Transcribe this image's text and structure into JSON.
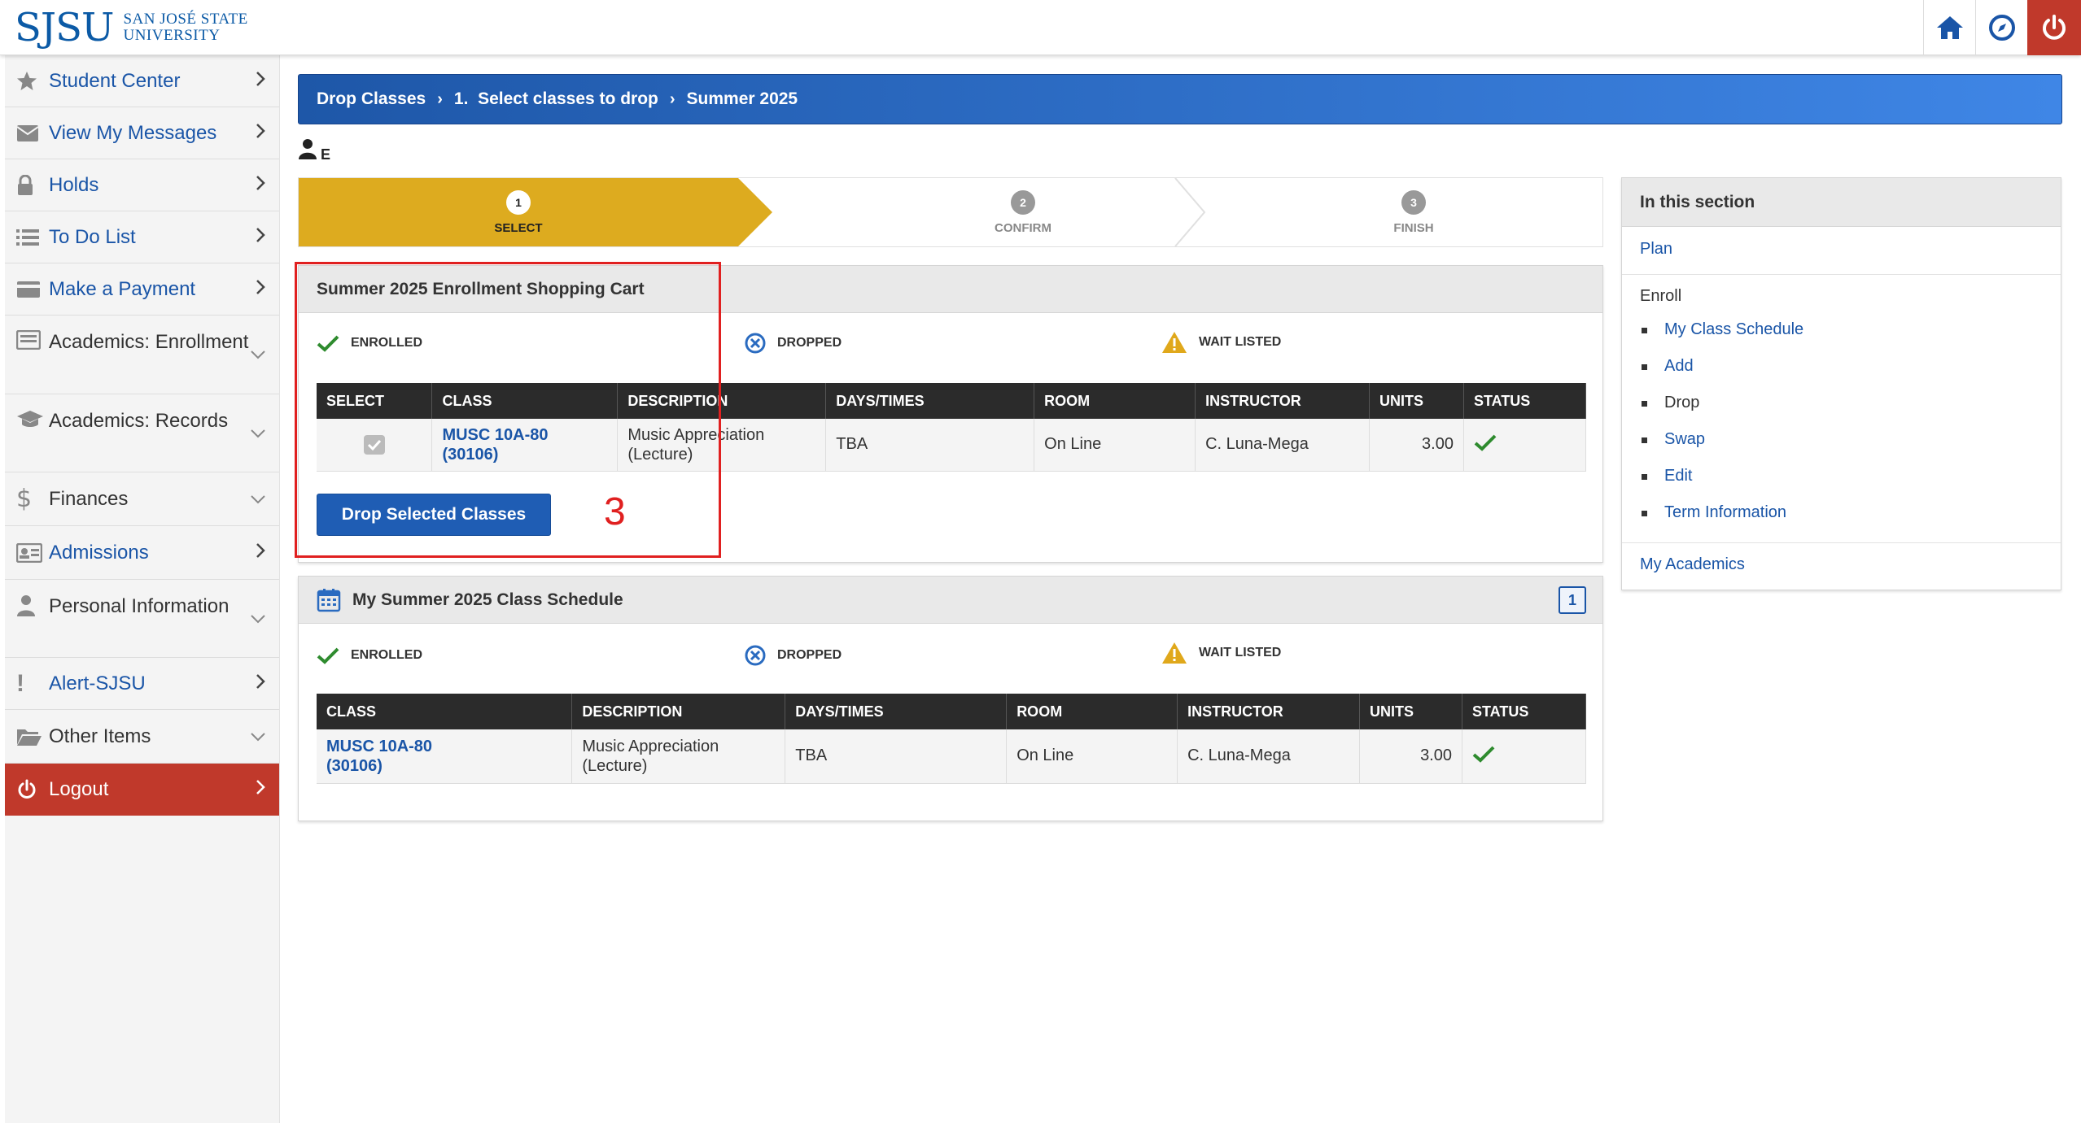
{
  "header": {
    "logo_mark": "SJSU",
    "logo_line1": "SAN JOSÉ STATE",
    "logo_line2": "UNIVERSITY"
  },
  "sidebar": {
    "items": [
      {
        "label": "Student Center",
        "icon": "star-icon",
        "arrow": "chevron-right"
      },
      {
        "label": "View My Messages",
        "icon": "envelope-icon",
        "arrow": "chevron-right"
      },
      {
        "label": "Holds",
        "icon": "lock-icon",
        "arrow": "chevron-right"
      },
      {
        "label": "To Do List",
        "icon": "list-icon",
        "arrow": "chevron-right"
      },
      {
        "label": "Make a Payment",
        "icon": "credit-card-icon",
        "arrow": "chevron-right"
      },
      {
        "label": "Academics: Enrollment",
        "icon": "enrollment-icon",
        "arrow": "chevron-down"
      },
      {
        "label": "Academics: Records",
        "icon": "graduation-cap-icon",
        "arrow": "chevron-down"
      },
      {
        "label": "Finances",
        "icon": "dollar-icon",
        "arrow": "chevron-down"
      },
      {
        "label": "Admissions",
        "icon": "id-card-icon",
        "arrow": "chevron-right"
      },
      {
        "label": "Personal Information",
        "icon": "person-icon",
        "arrow": "chevron-down"
      },
      {
        "label": "Alert-SJSU",
        "icon": "exclamation-icon",
        "arrow": "chevron-right"
      },
      {
        "label": "Other Items",
        "icon": "folder-icon",
        "arrow": "chevron-down"
      },
      {
        "label": "Logout",
        "icon": "power-icon",
        "arrow": "chevron-right"
      }
    ]
  },
  "breadcrumb": {
    "items": [
      "Drop Classes",
      "1.  Select classes to drop",
      "Summer 2025"
    ]
  },
  "user": {
    "name": "E"
  },
  "stepper": {
    "steps": [
      {
        "num": "1",
        "label": "SELECT"
      },
      {
        "num": "2",
        "label": "CONFIRM"
      },
      {
        "num": "3",
        "label": "FINISH"
      }
    ]
  },
  "legend": {
    "enrolled": "ENROLLED",
    "dropped": "DROPPED",
    "waitlisted": "WAIT LISTED"
  },
  "cart": {
    "title": "Summer 2025 Enrollment Shopping Cart",
    "headers": [
      "SELECT",
      "CLASS",
      "DESCRIPTION",
      "DAYS/TIMES",
      "ROOM",
      "INSTRUCTOR",
      "UNITS",
      "STATUS"
    ],
    "row": {
      "class_line1": "MUSC 10A-80",
      "class_line2": "(30106)",
      "desc_line1": "Music Appreciation",
      "desc_line2": "(Lecture)",
      "days": "TBA",
      "room": "On Line",
      "instructor": "C. Luna-Mega",
      "units": "3.00"
    },
    "drop_button": "Drop Selected Classes",
    "annotation": "3"
  },
  "schedule": {
    "title": "My Summer 2025 Class Schedule",
    "badge": "1",
    "headers": [
      "CLASS",
      "DESCRIPTION",
      "DAYS/TIMES",
      "ROOM",
      "INSTRUCTOR",
      "UNITS",
      "STATUS"
    ],
    "row": {
      "class_line1": "MUSC 10A-80",
      "class_line2": "(30106)",
      "desc_line1": "Music Appreciation",
      "desc_line2": "(Lecture)",
      "days": "TBA",
      "room": "On Line",
      "instructor": "C. Luna-Mega",
      "units": "3.00"
    }
  },
  "section": {
    "title": "In this section",
    "plan": "Plan",
    "enroll": "Enroll",
    "enroll_links": [
      "My Class Schedule",
      "Add",
      "Drop",
      "Swap",
      "Edit",
      "Term Information"
    ],
    "my_academics": "My Academics"
  },
  "colors": {
    "brand_blue": "#1a55a7",
    "step_active": "#ddab1f",
    "logout_red": "#c0392b",
    "annotation_red": "#e02020"
  }
}
